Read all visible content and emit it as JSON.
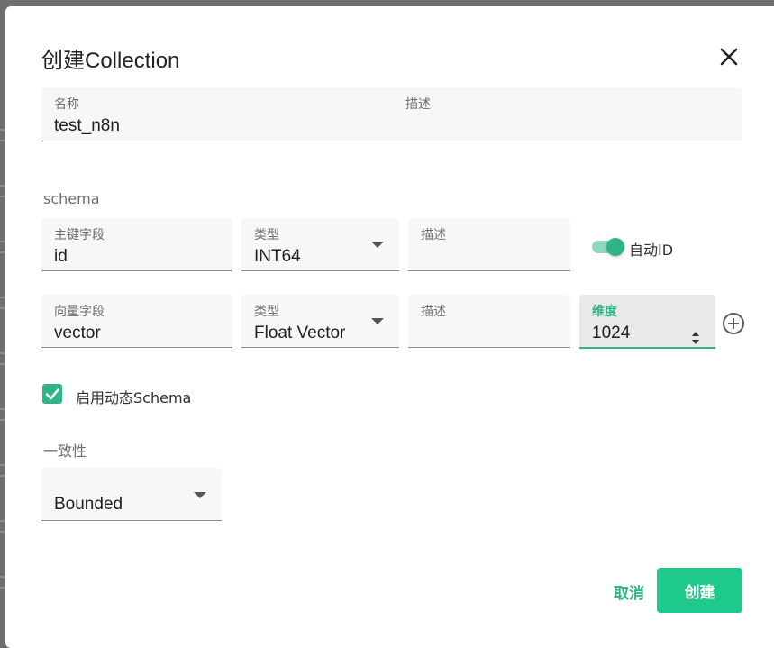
{
  "dialog": {
    "title": "创建Collection",
    "close_icon": "close-icon"
  },
  "collection": {
    "name_label": "名称",
    "name_value": "test_n8n",
    "desc_label": "描述",
    "desc_value": ""
  },
  "schema": {
    "section_label": "schema",
    "primary": {
      "field_label": "主键字段",
      "field_value": "id",
      "type_label": "类型",
      "type_value": "INT64",
      "desc_label": "描述",
      "desc_value": "",
      "auto_id_label": "自动ID",
      "auto_id_enabled": true
    },
    "vector": {
      "field_label": "向量字段",
      "field_value": "vector",
      "type_label": "类型",
      "type_value": "Float Vector",
      "desc_label": "描述",
      "desc_value": "",
      "dim_label": "维度",
      "dim_value": "1024",
      "add_icon": "add-circle-icon"
    }
  },
  "dynamic_schema": {
    "label": "启用动态Schema",
    "checked": true
  },
  "consistency": {
    "section_label": "一致性",
    "value": "Bounded"
  },
  "actions": {
    "cancel_label": "取消",
    "create_label": "创建"
  },
  "colors": {
    "accent": "#2fb585",
    "create_button": "#1fc98b"
  }
}
